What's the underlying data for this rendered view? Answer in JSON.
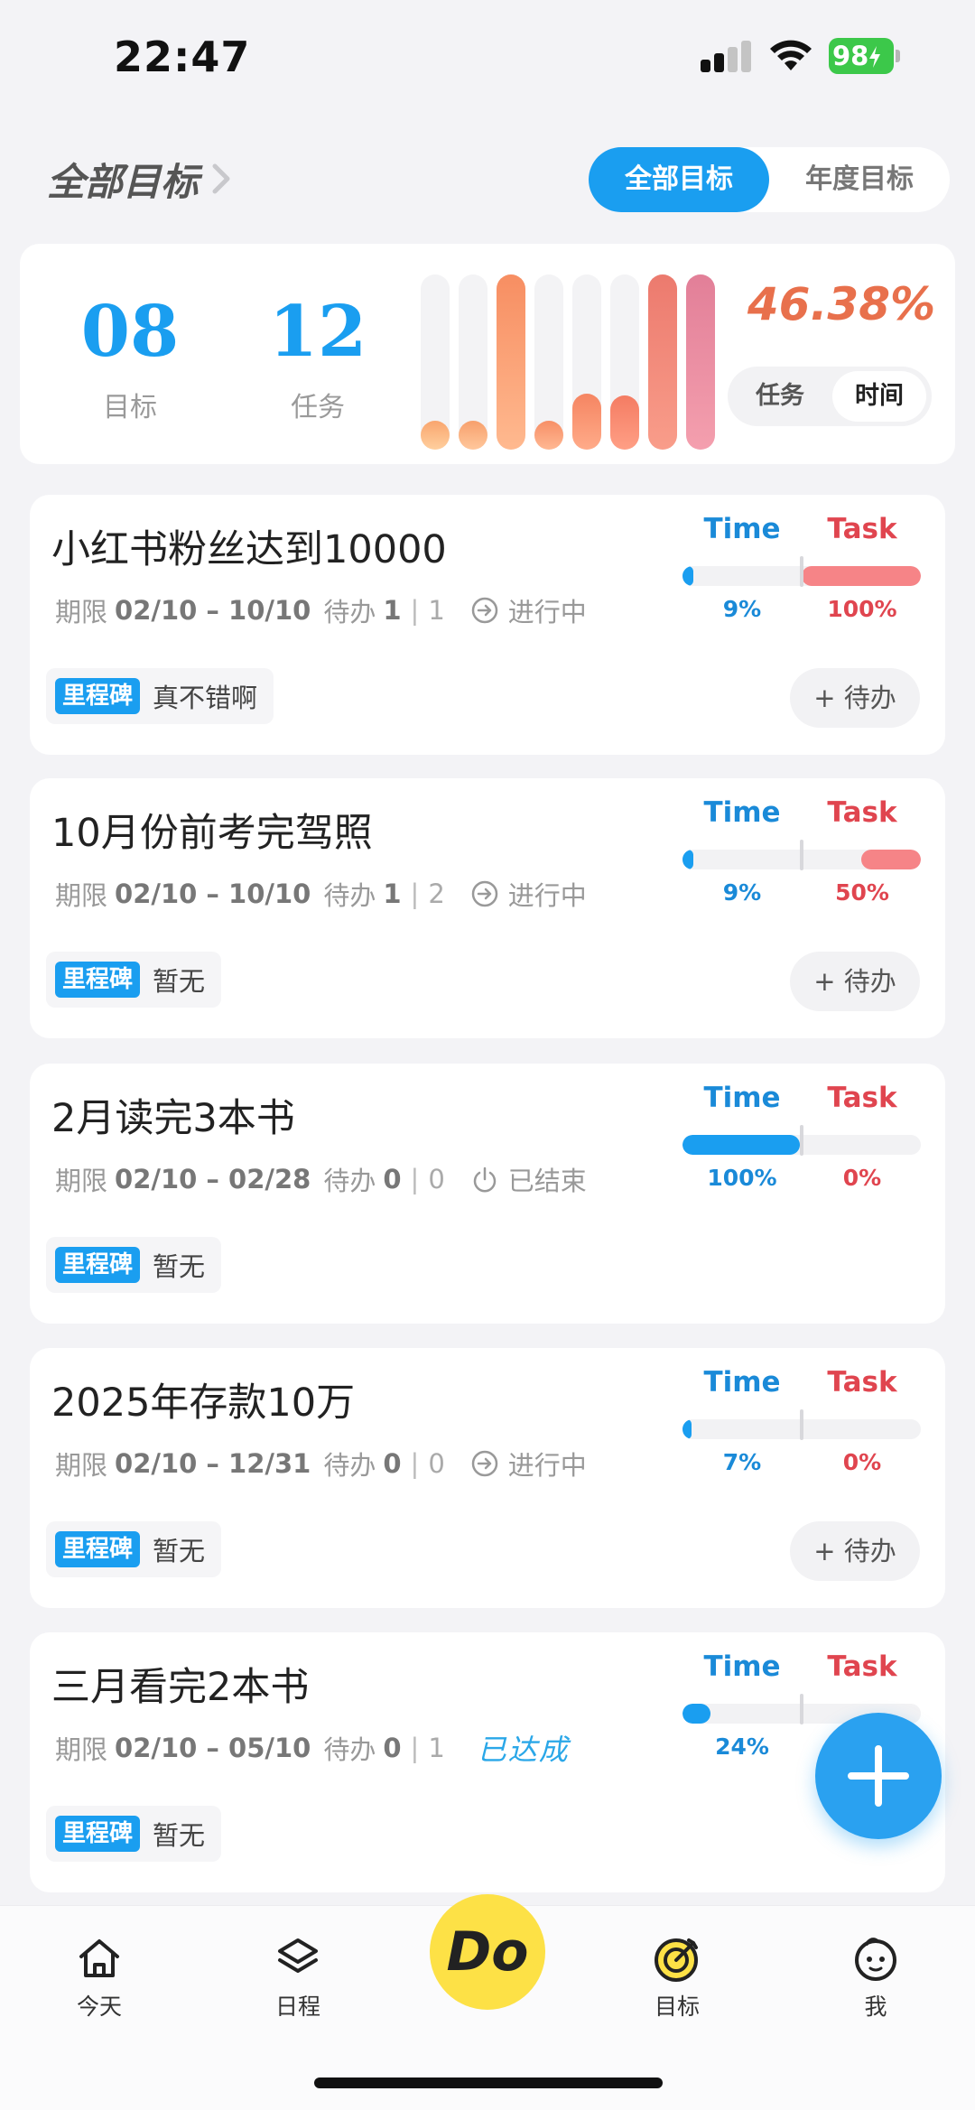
{
  "status_bar": {
    "time": "22:47",
    "battery": "98"
  },
  "header": {
    "title": "全部目标",
    "segment": {
      "options": [
        "全部目标",
        "年度目标"
      ],
      "selected": "全部目标"
    }
  },
  "stats": {
    "goal_count": "08",
    "goal_label": "目标",
    "task_count": "12",
    "task_label": "任务",
    "bar_levels": [
      0.12,
      0.12,
      1.0,
      0.12,
      0.32,
      0.31,
      1.0,
      1.0
    ],
    "percent": "46.38%",
    "toggle": {
      "options": [
        "任务",
        "时间"
      ],
      "selected": "时间"
    }
  },
  "goals": [
    {
      "title": "小红书粉丝达到10000",
      "period_label": "期限",
      "period": "02/10 – 10/10",
      "todo_label": "待办",
      "todo_open": "1",
      "todo_total": "1",
      "status": "进行中",
      "status_icon": "arrow-circle-icon",
      "milestone_tag": "里程碑",
      "milestone": "真不错啊",
      "todo_button": "+ 待办",
      "time_label": "Time",
      "task_label": "Task",
      "time_pct": "9%",
      "task_pct": "100%",
      "time_value": 0.09,
      "task_value": 1.0
    },
    {
      "title": "10月份前考完驾照",
      "period_label": "期限",
      "period": "02/10 – 10/10",
      "todo_label": "待办",
      "todo_open": "1",
      "todo_total": "2",
      "status": "进行中",
      "status_icon": "arrow-circle-icon",
      "milestone_tag": "里程碑",
      "milestone": "暂无",
      "todo_button": "+ 待办",
      "time_label": "Time",
      "task_label": "Task",
      "time_pct": "9%",
      "task_pct": "50%",
      "time_value": 0.09,
      "task_value": 0.5
    },
    {
      "title": "2月读完3本书",
      "period_label": "期限",
      "period": "02/10 – 02/28",
      "todo_label": "待办",
      "todo_open": "0",
      "todo_total": "0",
      "status": "已结束",
      "status_icon": "power-icon",
      "milestone_tag": "里程碑",
      "milestone": "暂无",
      "time_label": "Time",
      "task_label": "Task",
      "time_pct": "100%",
      "task_pct": "0%",
      "time_value": 1.0,
      "task_value": 0
    },
    {
      "title": "2025年存款10万",
      "period_label": "期限",
      "period": "02/10 – 12/31",
      "todo_label": "待办",
      "todo_open": "0",
      "todo_total": "0",
      "status": "进行中",
      "status_icon": "arrow-circle-icon",
      "milestone_tag": "里程碑",
      "milestone": "暂无",
      "todo_button": "+ 待办",
      "time_label": "Time",
      "task_label": "Task",
      "time_pct": "7%",
      "task_pct": "0%",
      "time_value": 0.07,
      "task_value": 0
    },
    {
      "title": "三月看完2本书",
      "period_label": "期限",
      "period": "02/10 – 05/10",
      "todo_label": "待办",
      "todo_open": "0",
      "todo_total": "1",
      "status": "已达成",
      "status_icon": "stamp",
      "milestone_tag": "里程碑",
      "milestone": "暂无",
      "time_label": "Time",
      "task_label": "Task",
      "time_pct": "24%",
      "time_value": 0.24
    }
  ],
  "tabs": [
    {
      "label": "今天",
      "icon": "house-icon"
    },
    {
      "label": "日程",
      "icon": "layers-icon"
    },
    {
      "label": "Do",
      "icon": "do-button"
    },
    {
      "label": "目标",
      "icon": "target-icon"
    },
    {
      "label": "我",
      "icon": "face-icon"
    }
  ],
  "colors": {
    "accent": "#1a9ef0",
    "task_red": "#e0454f",
    "percent_orange": "#e8704c",
    "do_yellow": "#fde146"
  }
}
